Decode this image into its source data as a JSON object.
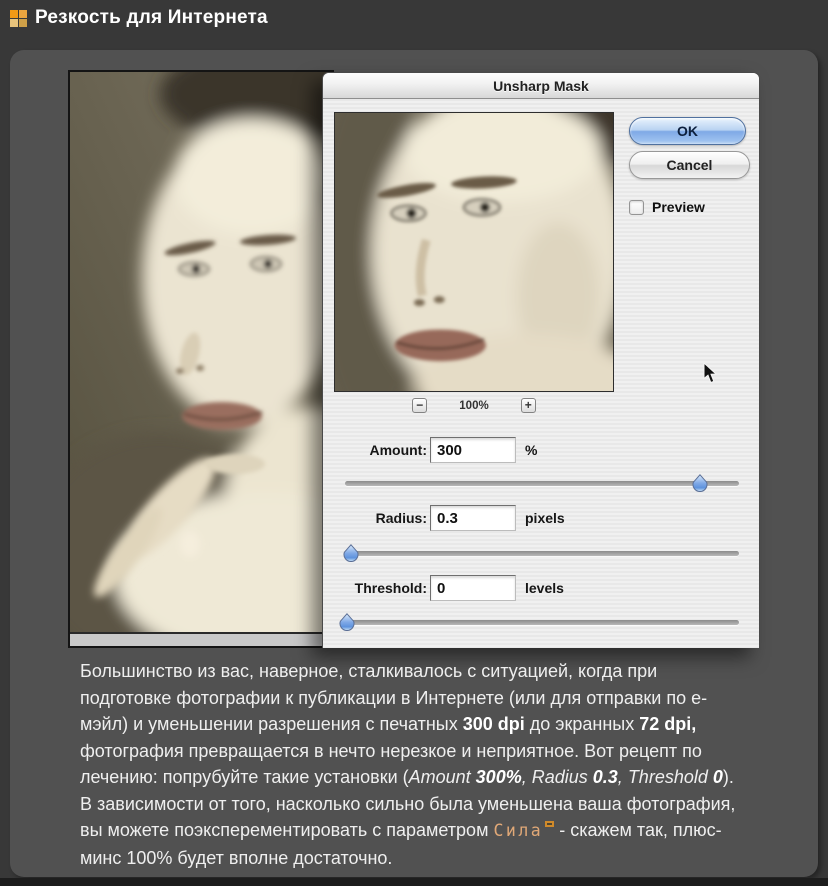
{
  "header": {
    "title": "Резкость для Интернета",
    "icon_colors": [
      "#f29a16",
      "#eda63f",
      "#e8c47c",
      "#cfa048"
    ]
  },
  "colors": {
    "page_bg": "#383838",
    "panel_bg": "#515151",
    "accent_orange": "#f29a16",
    "link_color": "#e0a877",
    "aqua_blue": "#7fa9e6",
    "dialog_bg": "#ececec"
  },
  "dialog": {
    "title": "Unsharp Mask",
    "ok_label": "OK",
    "cancel_label": "Cancel",
    "preview_label": "Preview",
    "preview_checked": false,
    "zoom": {
      "minus": "−",
      "value": "100%",
      "plus": "+"
    },
    "fields": [
      {
        "label": "Amount:",
        "value": "300",
        "suffix": "%",
        "slider_pct": 90
      },
      {
        "label": "Radius:",
        "value": "0.3",
        "suffix": "pixels",
        "slider_pct": 1.5
      },
      {
        "label": "Threshold:",
        "value": "0",
        "suffix": "levels",
        "slider_pct": 0.5
      }
    ]
  },
  "paragraph": {
    "runs": [
      {
        "t": "Большинство из вас, наверное, сталкивалось с ситуацией, когда при подготовке фотографии к публикации в Интернете (или для отправки по е-мэйл) и уменьшении разрешения с печатных ",
        "s": "n"
      },
      {
        "t": "300 dpi",
        "s": "b"
      },
      {
        "t": " до экранных ",
        "s": "n"
      },
      {
        "t": "72 dpi,",
        "s": "b"
      },
      {
        "t": " фотография превращается в нечто нерезкое и неприятное. Вот рецепт по лечению: попрубуйте такие установки (",
        "s": "n"
      },
      {
        "t": "Amount ",
        "s": "i"
      },
      {
        "t": "300%",
        "s": "bi"
      },
      {
        "t": ", ",
        "s": "i"
      },
      {
        "t": "Radius ",
        "s": "i"
      },
      {
        "t": "0.3",
        "s": "bi"
      },
      {
        "t": ", ",
        "s": "i"
      },
      {
        "t": "Threshold ",
        "s": "i"
      },
      {
        "t": "0",
        "s": "bi"
      },
      {
        "t": "). В зависимости от того, насколько сильно была уменьшена ваша фотография, вы можете поэксперементировать с параметром ",
        "s": "n"
      },
      {
        "t": "Сила",
        "s": "link"
      },
      {
        "t": "",
        "s": "sq"
      },
      {
        "t": " - скажем так, плюс-минс 100% будет вполне достаточно.",
        "s": "n"
      }
    ]
  }
}
